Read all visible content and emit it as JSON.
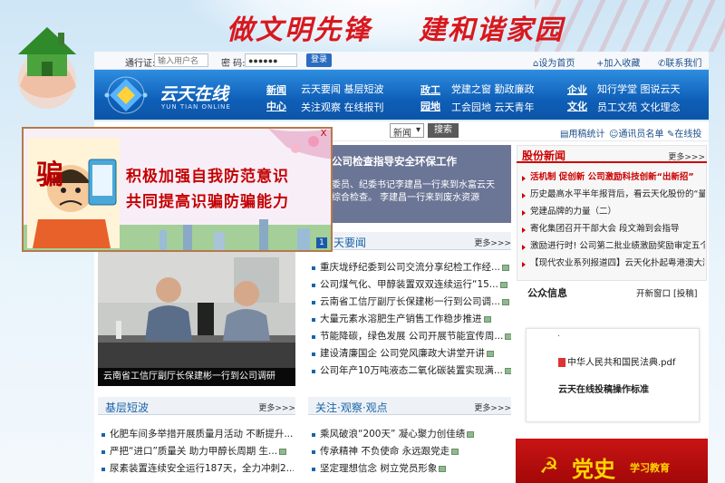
{
  "banner": {
    "slogan_left": "做文明先锋",
    "slogan_right": "建和谐家园"
  },
  "login": {
    "user_label": "通行证:",
    "user_placeholder": "输入用户名",
    "pass_label": "密  码:",
    "pass_value": "●●●●●●",
    "login_button": "登录",
    "home_link": "设为首页",
    "fav_link": "+加入收藏",
    "contact_link": "联系我们"
  },
  "nav": {
    "logo_cn": "云天在线",
    "logo_en": "YUN TIAN ONLINE",
    "groups": [
      {
        "head1": "新闻",
        "head2": "中心",
        "row1": "云天要闻 基层短波",
        "row2": "关注观察 在线报刊"
      },
      {
        "head1": "政工",
        "head2": "园地",
        "row1": "党建之窗 勤政廉政",
        "row2": "工会园地 云天青年"
      },
      {
        "head1": "企业",
        "head2": "文化",
        "row1": "知行学堂 图说云天",
        "row2": "员工文苑 文化理念"
      }
    ]
  },
  "search": {
    "select_value": "新闻",
    "button": "搜索",
    "tools": [
      "用稿统计",
      "通讯员名单",
      "在线投稿"
    ]
  },
  "popup_ad": {
    "line1": "积极加强自我防范意识",
    "line2": "共同提高识骗防骗能力",
    "close": "X",
    "page": "1",
    "sign": "骗"
  },
  "feature": {
    "title": "公司检查指导安全环保工作",
    "text1": "委员、纪委书记李建昌一行来到水富云天",
    "text2": "综合检查。    李建昌一行来到废水资源"
  },
  "yaowen": {
    "title_fragment": "天要闻",
    "more": "更多>>>",
    "items": [
      "重庆垅纾纪委到公司交流分享纪检工作经...",
      "公司煤气化、甲醇装置双双连续运行“15...",
      "云南省工信厅副厅长保建彬一行到公司调...",
      "大量元素水溶肥生产销售工作稳步推进",
      "节能降碳，绿色发展 公司开展节能宣传周...",
      "建设清廉国企 公司党风廉政大讲堂开讲",
      "公司年产10万吨液态二氧化碳装置实现满..."
    ]
  },
  "photo_caption": "云南省工信厅副厅长保建彬一行到公司调研",
  "jiceng": {
    "title": "基层短波",
    "more": "更多>>>",
    "items": [
      "化肥车间多举措开展质量月活动 不断提升...",
      "严把“进口”质量关 助力甲醇长周期 生...",
      "尿素装置连续安全运行187天，全力冲刺2..."
    ]
  },
  "guanzhu": {
    "title": "关注·观察·观点",
    "more": "更多>>>",
    "items": [
      "乘风破浪“200天” 凝心聚力创佳绩",
      "传承精神 不负使命 永远跟党走",
      "坚定理想信念 树立党员形象"
    ]
  },
  "gufen": {
    "title": "股份新闻",
    "more": "更多>>>",
    "items": [
      "活机制 促创新 公司激励科技创新“出新招”",
      "历史最高水平半年报背后，看云天化股份的“量”...",
      "党建品牌的力量（二）",
      "寄化集团召开干部大会 段文瀚到会指导",
      "激励进行时! 公司第二批业绩激励奖励审定五个新...",
      "【现代农业系列报道四】云天化扑起粤港澳大湾区..."
    ]
  },
  "public_info": {
    "title": "公众信息",
    "right": "开新窗口 [投稿]",
    "dot": "·",
    "pdf": "中华人民共和国民法典.pdf",
    "guide": "云天在线投稿操作标准"
  },
  "party_banner": {
    "big": "党史",
    "small": "学习教育"
  }
}
